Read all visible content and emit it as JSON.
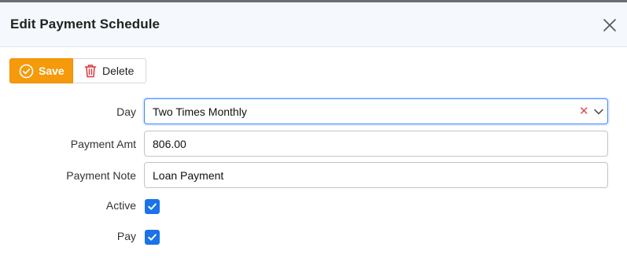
{
  "dialog": {
    "title": "Edit Payment Schedule",
    "close_icon": "close-icon"
  },
  "toolbar": {
    "save_label": "Save",
    "save_icon": "check-circle-icon",
    "delete_label": "Delete",
    "delete_icon": "trash-icon"
  },
  "form": {
    "day": {
      "label": "Day",
      "value": "Two Times Monthly"
    },
    "payment_amt": {
      "label": "Payment Amt",
      "value": "806.00"
    },
    "payment_note": {
      "label": "Payment Note",
      "value": "Loan Payment"
    },
    "active": {
      "label": "Active",
      "checked": true
    },
    "pay": {
      "label": "Pay",
      "checked": true
    }
  },
  "colors": {
    "accent": "#f59a0a",
    "checkbox": "#1a73e8",
    "focus_border": "#3d86ff",
    "clear_x": "#d9534f"
  }
}
